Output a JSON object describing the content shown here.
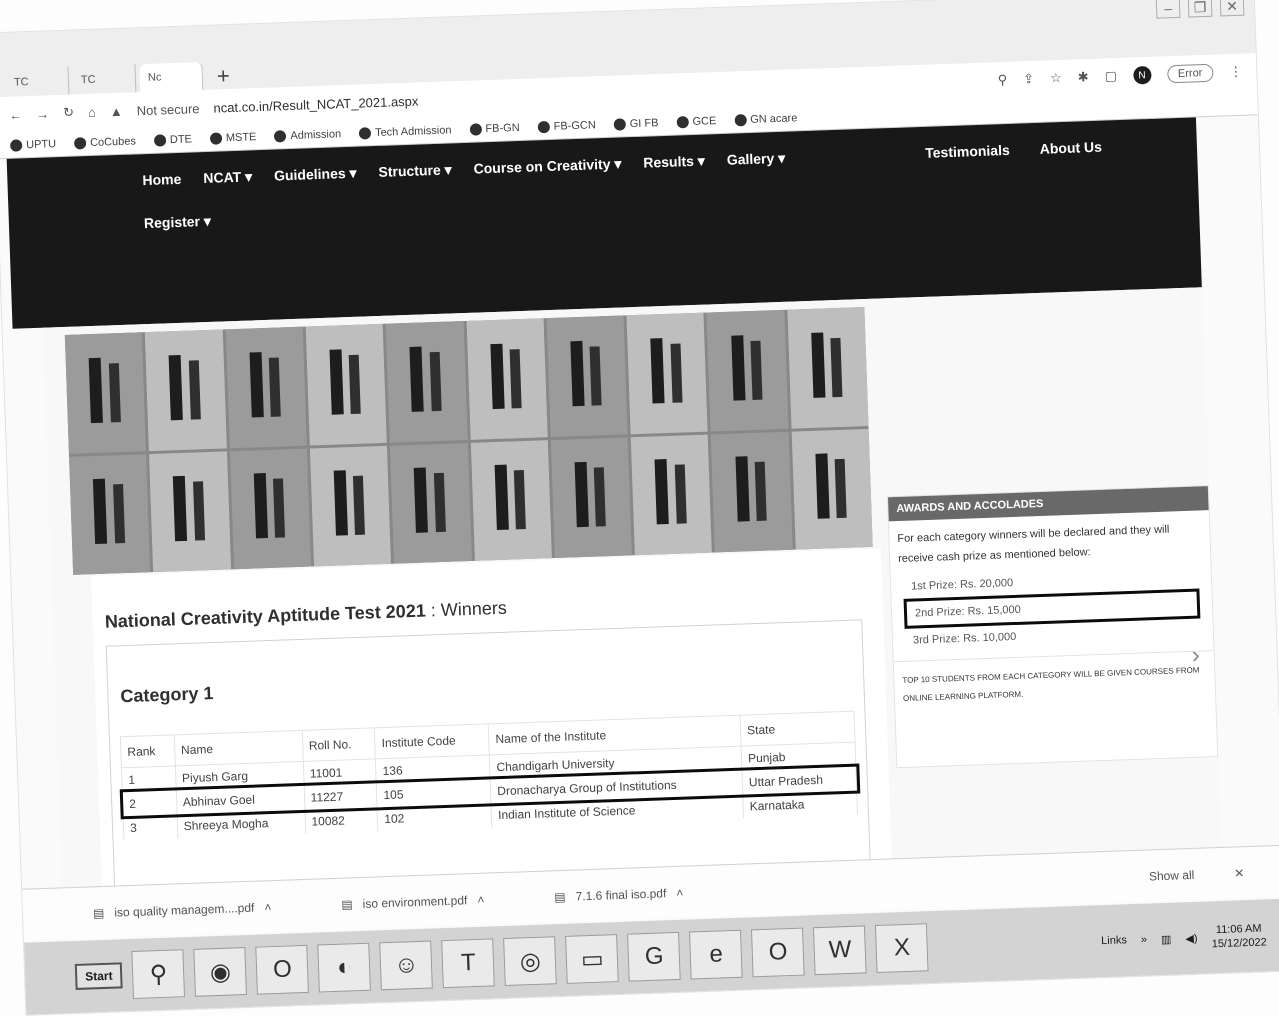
{
  "browser": {
    "tabs": [
      "TC",
      "TC",
      "Nc"
    ],
    "new_tab": "+",
    "address": {
      "not_secure": "Not secure",
      "url": "ncat.co.in/Result_NCAT_2021.aspx"
    },
    "profile_initial": "N",
    "error_label": "Error",
    "bookmarks": [
      "UPTU",
      "CoCubes",
      "DTE",
      "MSTE",
      "Admission",
      "Tech Admission",
      "FB-GN",
      "FB-GCN",
      "GI FB",
      "GCE",
      "GN acare"
    ]
  },
  "nav": {
    "items": [
      "Home",
      "NCAT ▾",
      "Guidelines ▾",
      "Structure ▾",
      "Course on Creativity ▾",
      "Results ▾",
      "Gallery ▾"
    ],
    "right_items": [
      "Testimonials",
      "About Us"
    ],
    "register": "Register ▾"
  },
  "main": {
    "title": "National Creativity Aptitude Test 2021",
    "title_suffix": ": Winners",
    "category": "Category 1",
    "columns": [
      "Rank",
      "Name",
      "Roll No.",
      "Institute Code",
      "Name of the Institute",
      "State"
    ],
    "rows": [
      {
        "rank": "1",
        "name": "Piyush Garg",
        "roll": "11001",
        "code": "136",
        "institute": "Chandigarh University",
        "state": "Punjab"
      },
      {
        "rank": "2",
        "name": "Abhinav Goel",
        "roll": "11227",
        "code": "105",
        "institute": "Dronacharya Group of Institutions",
        "state": "Uttar Pradesh"
      },
      {
        "rank": "3",
        "name": "Shreeya Mogha",
        "roll": "10082",
        "code": "102",
        "institute": "Indian Institute of Science",
        "state": "Karnataka"
      }
    ]
  },
  "sidebar": {
    "heading": "AWARDS AND ACCOLADES",
    "text": "For each category winners will be declared and they will receive cash prize as mentioned below:",
    "prizes": [
      "1st Prize: Rs. 20,000",
      "2nd Prize: Rs. 15,000",
      "3rd Prize: Rs. 10,000"
    ],
    "note": "TOP 10 STUDENTS FROM EACH CATEGORY WILL BE GIVEN COURSES FROM ONLINE LEARNING PLATFORM."
  },
  "downloads": {
    "items": [
      "iso quality managem....pdf",
      "iso environment.pdf",
      "7.1.6 final iso.pdf"
    ],
    "show_all": "Show all"
  },
  "taskbar": {
    "start": "Start",
    "lang": "Links",
    "time": "11:06 AM",
    "date": "15/12/2022"
  }
}
